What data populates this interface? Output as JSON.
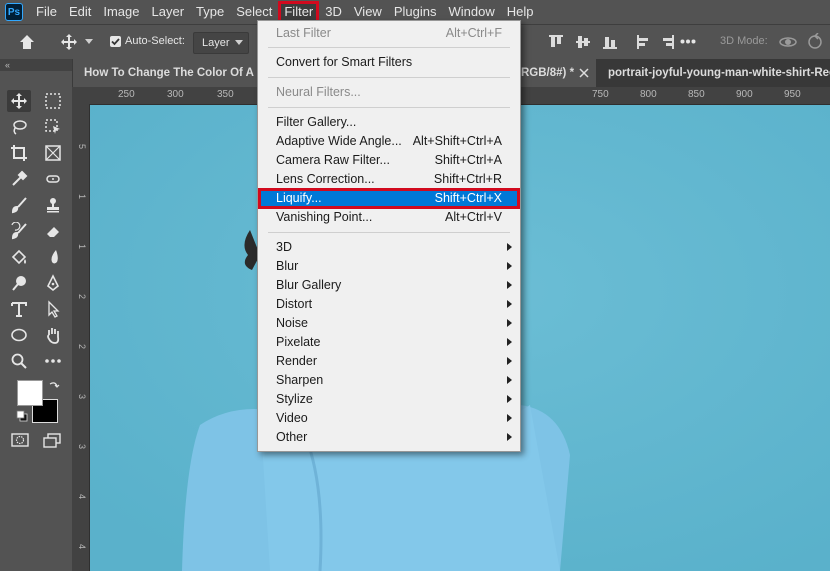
{
  "menubar": {
    "logo": "Ps",
    "items": [
      "File",
      "Edit",
      "Image",
      "Layer",
      "Type",
      "Select",
      "Filter",
      "3D",
      "View",
      "Plugins",
      "Window",
      "Help"
    ]
  },
  "options": {
    "auto_select_label": "Auto-Select:",
    "layer_select": "Layer",
    "mode_3d": "3D Mode:"
  },
  "tabs": {
    "active": "How To Change The Color Of A S",
    "active_suffix": "RGB/8#) *",
    "other": "portrait-joyful-young-man-white-shirt-Rec"
  },
  "ruler": {
    "top": [
      "250",
      "300",
      "350",
      "750",
      "800",
      "850",
      "900",
      "950"
    ],
    "left": [
      "5",
      "1",
      "1",
      "2",
      "2",
      "3",
      "3",
      "4",
      "4"
    ]
  },
  "filter_menu": {
    "last_filter": {
      "label": "Last Filter",
      "shortcut": "Alt+Ctrl+F"
    },
    "convert": "Convert for Smart Filters",
    "neural": "Neural Filters...",
    "items": [
      {
        "label": "Filter Gallery...",
        "shortcut": ""
      },
      {
        "label": "Adaptive Wide Angle...",
        "shortcut": "Alt+Shift+Ctrl+A"
      },
      {
        "label": "Camera Raw Filter...",
        "shortcut": "Shift+Ctrl+A"
      },
      {
        "label": "Lens Correction...",
        "shortcut": "Shift+Ctrl+R"
      },
      {
        "label": "Liquify...",
        "shortcut": "Shift+Ctrl+X"
      },
      {
        "label": "Vanishing Point...",
        "shortcut": "Alt+Ctrl+V"
      }
    ],
    "submenus": [
      "3D",
      "Blur",
      "Blur Gallery",
      "Distort",
      "Noise",
      "Pixelate",
      "Render",
      "Sharpen",
      "Stylize",
      "Video",
      "Other"
    ]
  },
  "colors": {
    "highlight": "#0078d7",
    "callout": "#d10a1e",
    "canvas_bg": "#5fb6cf",
    "sweater": "#7ec3e6"
  }
}
